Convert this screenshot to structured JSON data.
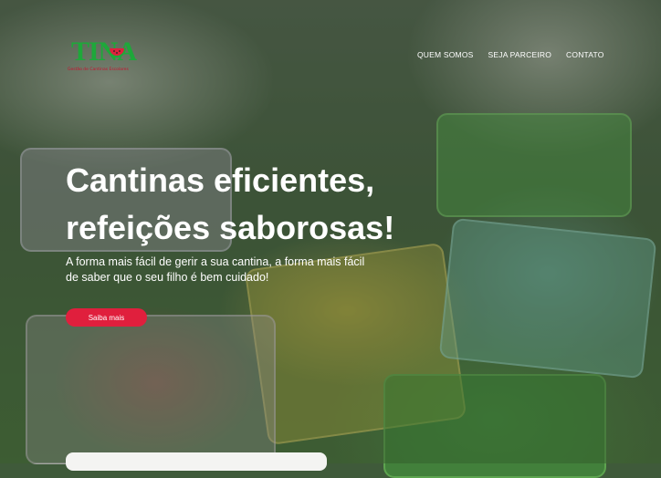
{
  "logo": {
    "mark": "TINA",
    "tagline": "Gestão de Cantinas Escolares",
    "icon": "watermelon-icon"
  },
  "nav": {
    "items": [
      {
        "label": "QUEM SOMOS"
      },
      {
        "label": "SEJA PARCEIRO"
      },
      {
        "label": "CONTATO"
      }
    ]
  },
  "hero": {
    "headline_line1": "Cantinas eficientes,",
    "headline_line2": "refeições saborosas!",
    "subtext": "A forma mais fácil de gerir a sua cantina, a forma mais fácil de saber que o seu filho é bem cuidado!",
    "cta_label": "Saiba mais"
  },
  "colors": {
    "accent": "#e01f3d",
    "brand_green": "#1ea83a",
    "text": "#ffffff"
  }
}
